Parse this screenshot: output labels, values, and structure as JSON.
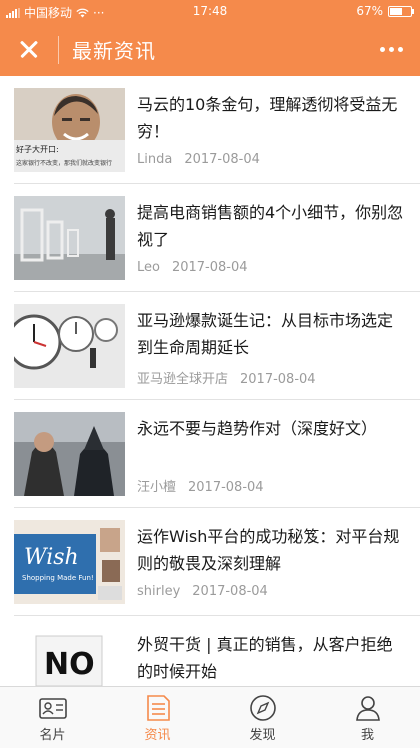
{
  "status_bar": {
    "carrier": "中国移动",
    "dots": "···",
    "time": "17:48",
    "battery_text": "67%",
    "battery_level": 0.67
  },
  "nav": {
    "title": "最新资讯"
  },
  "articles": [
    {
      "title": "马云的10条金句，理解透彻将受益无穷！",
      "author": "Linda",
      "date": "2017-08-04"
    },
    {
      "title": "提高电商销售额的4个小细节，你别忽视了",
      "author": "Leo",
      "date": "2017-08-04"
    },
    {
      "title": "亚马逊爆款诞生记：从目标市场选定到生命周期延长",
      "author": "亚马逊全球开店",
      "date": "2017-08-04"
    },
    {
      "title": "永远不要与趋势作对（深度好文）",
      "author": "汪小檀",
      "date": "2017-08-04"
    },
    {
      "title": "运作Wish平台的成功秘笈：对平台规则的敬畏及深刻理解",
      "author": "shirley",
      "date": "2017-08-04"
    },
    {
      "title": "外贸干货 | 真正的销售，从客户拒绝的时候开始",
      "author": "",
      "date": ""
    }
  ],
  "thumb_text": {
    "banner_line1": "好子大开口:",
    "banner_line2": "这家银行不改变，那我们就改变银行",
    "wish_logo": "Wish",
    "wish_tagline": "Shopping Made Fun!",
    "no_sign": "NO"
  },
  "tabs": [
    {
      "label": "名片",
      "icon": "contact-card-icon"
    },
    {
      "label": "资讯",
      "icon": "news-icon"
    },
    {
      "label": "发现",
      "icon": "compass-icon"
    },
    {
      "label": "我",
      "icon": "person-icon"
    }
  ],
  "colors": {
    "accent": "#f58a4b",
    "meta_text": "#9b9b9b"
  }
}
